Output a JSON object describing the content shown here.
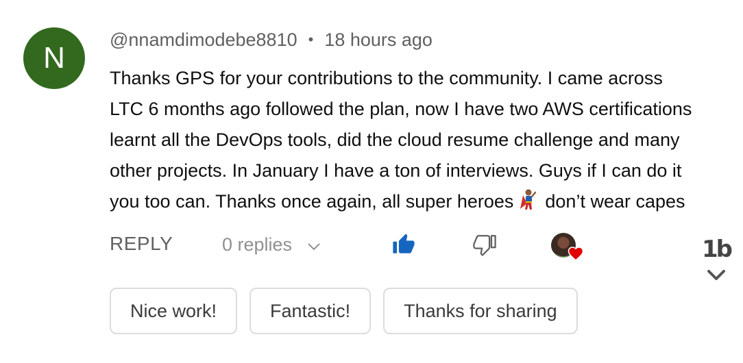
{
  "comment": {
    "avatar_letter": "N",
    "avatar_color": "#33691e",
    "author": "@nnamdimodebe8810",
    "separator": "•",
    "timestamp": "18 hours ago",
    "lines": [
      "Thanks GPS for your contributions to the community. I came across",
      "LTC 6 months ago followed the plan, now I have two AWS certifications",
      "learnt all the DevOps tools, did the cloud resume challenge and many",
      "other projects. In January I have a ton of interviews. Guys if I can do it"
    ],
    "last_line_before_icon": "you too can. Thanks once again, all super heroes",
    "last_line_after_icon": "don’t wear capes",
    "inline_icon": "superhero-emoji-icon"
  },
  "actions": {
    "reply_label": "REPLY",
    "replies_label": "0 replies",
    "replies_icon": "chevron-down-icon",
    "like_icon": "thumbs-up-icon",
    "like_color": "#1565c0",
    "dislike_icon": "thumbs-down-icon",
    "creator_heart_icon": "creator-heart-icon",
    "heart_color": "#e00000"
  },
  "side": {
    "logo_text": "1b",
    "expand_icon": "chevron-down-icon"
  },
  "suggestions": [
    {
      "label": "Nice work!"
    },
    {
      "label": "Fantastic!"
    },
    {
      "label": "Thanks for sharing"
    }
  ]
}
